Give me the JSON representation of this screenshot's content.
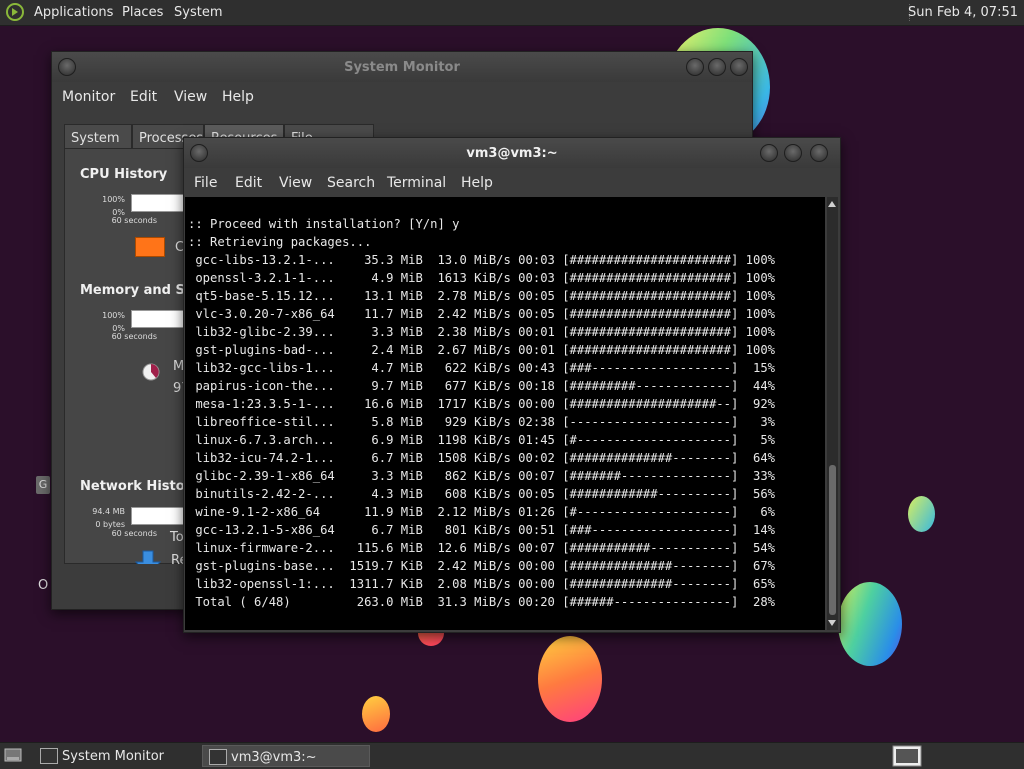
{
  "top_panel": {
    "applications": "Applications",
    "places": "Places",
    "system": "System",
    "clock": "Sun Feb  4, 07:51"
  },
  "system_monitor": {
    "title": "System Monitor",
    "menu": [
      "Monitor",
      "Edit",
      "View",
      "Help"
    ],
    "tabs": [
      "System",
      "Processes",
      "Resources",
      "File Systems"
    ],
    "active_tab": "Resources",
    "cpu": {
      "title": "CPU History",
      "pct_top": "100%",
      "pct_bottom": "0%",
      "time": "60 seconds",
      "legend_partial": "C",
      "swatch_color": "#ff7418"
    },
    "memory": {
      "title": "Memory and Swap History",
      "pct_top": "100%",
      "pct_bottom": "0%",
      "time": "60 seconds",
      "label_partial": "M",
      "value_partial": "97"
    },
    "network": {
      "title": "Network History",
      "top": "94.4 MB",
      "bottom": "0 bytes",
      "time": "60 seconds",
      "recv_partial": "Re",
      "total_partial": "To"
    }
  },
  "desktop": {
    "left_g": "G",
    "left_o": "O"
  },
  "terminal": {
    "title": "vm3@vm3:~",
    "menu": [
      "File",
      "Edit",
      "View",
      "Search",
      "Terminal",
      "Help"
    ],
    "lines": [
      "",
      ":: Proceed with installation? [Y/n] y",
      ":: Retrieving packages...",
      " gcc-libs-13.2.1-...    35.3 MiB  13.0 MiB/s 00:03 [######################] 100%",
      " openssl-3.2.1-1-...     4.9 MiB  1613 KiB/s 00:03 [######################] 100%",
      " qt5-base-5.15.12...    13.1 MiB  2.78 MiB/s 00:05 [######################] 100%",
      " vlc-3.0.20-7-x86_64    11.7 MiB  2.42 MiB/s 00:05 [######################] 100%",
      " lib32-glibc-2.39...     3.3 MiB  2.38 MiB/s 00:01 [######################] 100%",
      " gst-plugins-bad-...     2.4 MiB  2.67 MiB/s 00:01 [######################] 100%",
      " lib32-gcc-libs-1...     4.7 MiB   622 KiB/s 00:43 [###-------------------]  15%",
      " papirus-icon-the...     9.7 MiB   677 KiB/s 00:18 [#########-------------]  44%",
      " mesa-1:23.3.5-1-...    16.6 MiB  1717 KiB/s 00:00 [####################--]  92%",
      " libreoffice-stil...     5.8 MiB   929 KiB/s 02:38 [----------------------]   3%",
      " linux-6.7.3.arch...     6.9 MiB  1198 KiB/s 01:45 [#---------------------]   5%",
      " lib32-icu-74.2-1...     6.7 MiB  1508 KiB/s 00:02 [##############--------]  64%",
      " glibc-2.39-1-x86_64     3.3 MiB   862 KiB/s 00:07 [#######---------------]  33%",
      " binutils-2.42-2-...     4.3 MiB   608 KiB/s 00:05 [############----------]  56%",
      " wine-9.1-2-x86_64      11.9 MiB  2.12 MiB/s 01:26 [#---------------------]   6%",
      " gcc-13.2.1-5-x86_64     6.7 MiB   801 KiB/s 00:51 [###-------------------]  14%",
      " linux-firmware-2...   115.6 MiB  12.6 MiB/s 00:07 [###########-----------]  54%",
      " gst-plugins-base...  1519.7 KiB  2.42 MiB/s 00:00 [##############--------]  67%",
      " lib32-openssl-1:...  1311.7 KiB  2.08 MiB/s 00:00 [##############--------]  65%",
      " Total ( 6/48)         263.0 MiB  31.3 MiB/s 00:20 [######----------------]  28%"
    ]
  },
  "taskbar": {
    "items": [
      "System Monitor",
      "vm3@vm3:~"
    ],
    "active": "vm3@vm3:~"
  }
}
